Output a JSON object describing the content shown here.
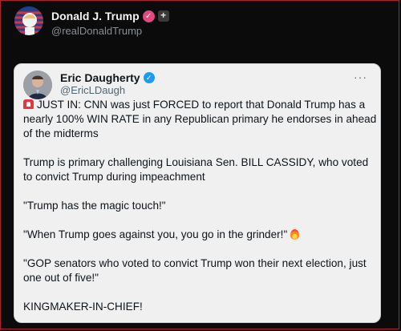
{
  "post": {
    "display_name": "Donald J. Trump",
    "handle": "@realDonaldTrump",
    "badge_check": "✓",
    "badge_plus": "+"
  },
  "quoted_post": {
    "display_name": "Eric Daugherty",
    "handle": "@EricLDaugh",
    "badge_check": "✓",
    "more_label": "···",
    "paragraphs": [
      "JUST IN: CNN was just FORCED to report that Donald Trump has a nearly 100% WIN RATE in any Republican primary he endorses in ahead of the midterms",
      "Trump is primary challenging Louisiana Sen. BILL CASSIDY, who voted to convict Trump during impeachment",
      "\"Trump has the magic touch!\"",
      "\"When Trump goes against you, you go in the grinder!\"",
      "\"GOP senators who voted to convict Trump won their next election, just one out of five!\"",
      "KINGMAKER-IN-CHIEF!"
    ]
  },
  "colors": {
    "background": "#0b0b0b",
    "card": "#f0f0f1",
    "verified_blue": "#1d9bf0",
    "verified_pink": "#e0497d"
  },
  "icons": {
    "siren": "rotating-light-icon",
    "fire": "fire-icon"
  }
}
